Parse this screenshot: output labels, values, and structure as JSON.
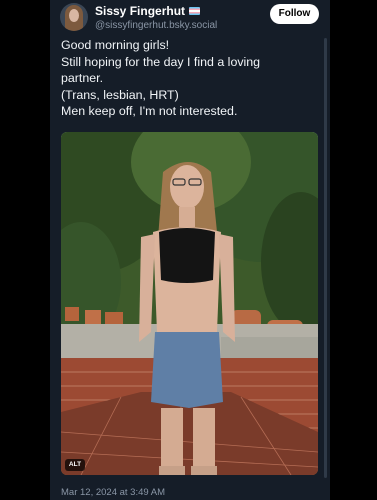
{
  "post": {
    "display_name": "Sissy Fingerhut",
    "name_flag_icon": "trans-flag-icon",
    "handle": "@sissyfingerhut.bsky.social",
    "follow_label": "Follow",
    "text_lines": [
      "Good morning girls!",
      "Still hoping for the day I find a loving",
      "partner.",
      "(Trans, lesbian, HRT)",
      "Men keep off, I'm not interested."
    ],
    "alt_badge": "ALT",
    "timestamp": "Mar 12, 2024 at 3:49 AM"
  },
  "colors": {
    "page_background": "#000000",
    "card_background": "#151d28",
    "secondary_text": "#8a96a6",
    "follow_button_bg": "#ffffff"
  }
}
